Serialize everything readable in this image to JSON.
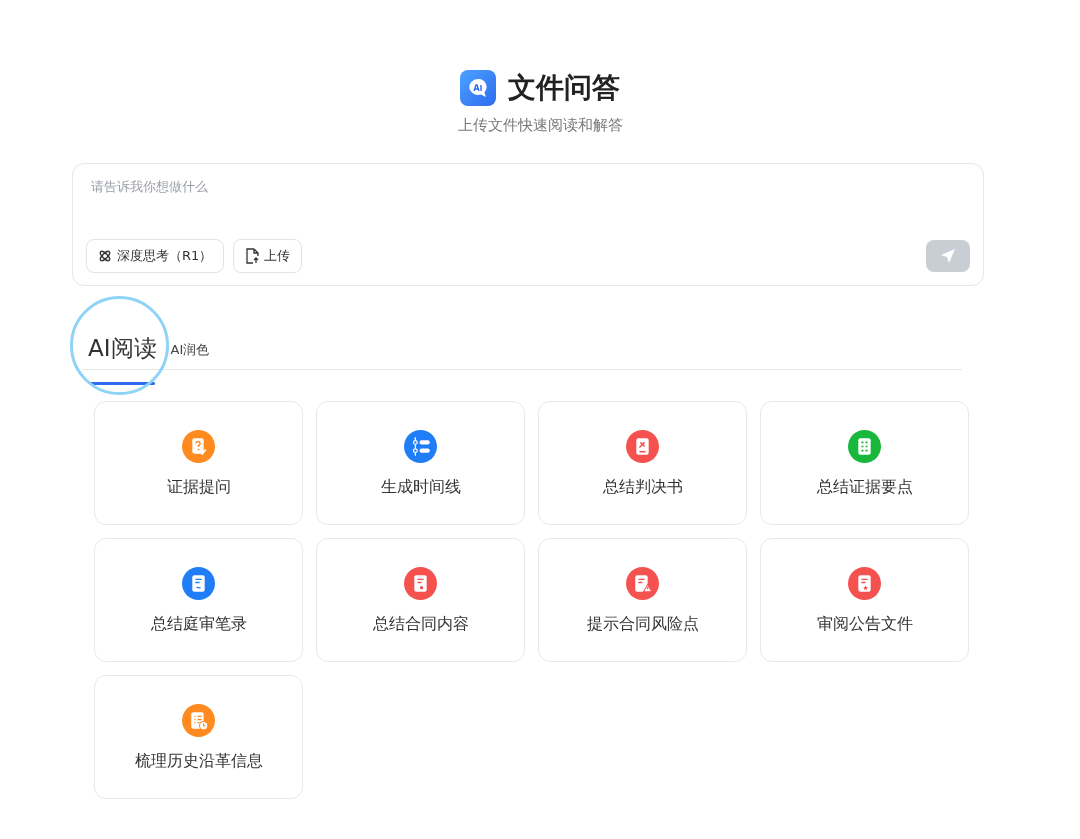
{
  "header": {
    "title": "文件问答",
    "subtitle": "上传文件快速阅读和解答"
  },
  "prompt": {
    "placeholder": "请告诉我你想做什么",
    "buttons": [
      {
        "kind": "think",
        "label": "深度思考（R1）"
      },
      {
        "kind": "upload",
        "label": "上传"
      }
    ],
    "send_disabled": true
  },
  "tabs": [
    {
      "label": "AI阅读",
      "selected": true
    },
    {
      "label": "AI润色",
      "selected": false
    }
  ],
  "cards": [
    {
      "label": "证据提问",
      "kind": "question",
      "color": "#ff8a1f"
    },
    {
      "label": "生成时间线",
      "kind": "timeline",
      "color": "#1f7df5"
    },
    {
      "label": "总结判决书",
      "kind": "gavel",
      "color": "#f5524f"
    },
    {
      "label": "总结证据要点",
      "kind": "checklist",
      "color": "#19b83c"
    },
    {
      "label": "总结庭审笔录",
      "kind": "transcript",
      "color": "#1f7df5"
    },
    {
      "label": "总结合同内容",
      "kind": "contract",
      "color": "#f5524f"
    },
    {
      "label": "提示合同风险点",
      "kind": "risk",
      "color": "#f5524f"
    },
    {
      "label": "审阅公告文件",
      "kind": "notice",
      "color": "#f5524f"
    },
    {
      "label": "梳理历史沿革信息",
      "kind": "history",
      "color": "#ff8a1f"
    }
  ]
}
